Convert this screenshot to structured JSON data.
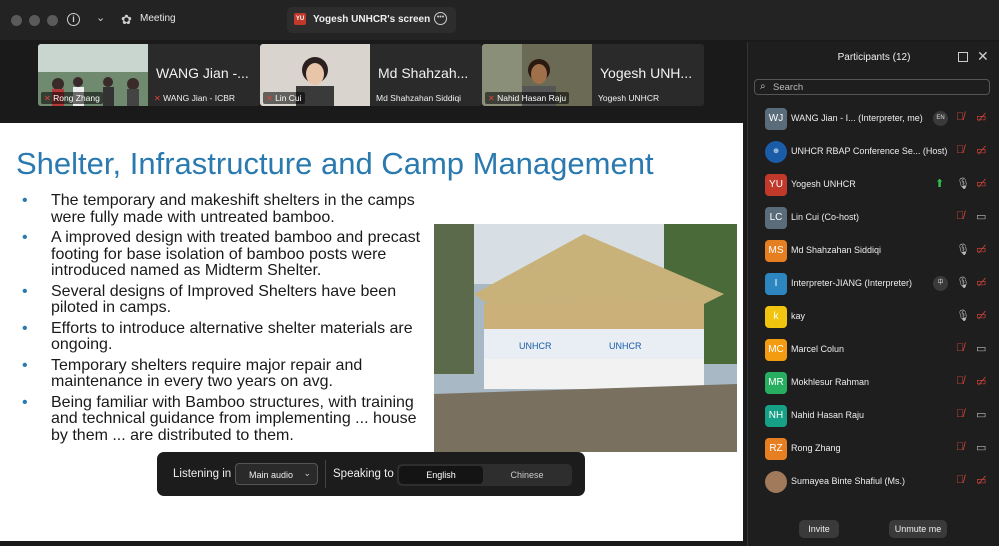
{
  "titlebar": {
    "meeting_label": "Meeting",
    "share_badge": "YU",
    "share_label": "Yogesh UNHCR's screen"
  },
  "strip": {
    "tiles": [
      {
        "thumb_label": "Rong Zhang",
        "big_name": "WANG Jian -...",
        "small_name": "WANG Jian - ICBR"
      },
      {
        "thumb_label": "Lin Cui",
        "big_name": "Md Shahzah...",
        "small_name": "Md Shahzahan Siddiqi"
      },
      {
        "thumb_label": "Nahid Hasan Raju",
        "big_name": "Yogesh UNH...",
        "small_name": "Yogesh UNHCR"
      }
    ]
  },
  "slide": {
    "title": "Shelter, Infrastructure and Camp Management",
    "bullets": [
      "The temporary and makeshift shelters in the camps were fully made with untreated bamboo.",
      "A improved design with treated bamboo and precast footing for base isolation of bamboo posts were introduced named as Midterm Shelter.",
      "Several designs of Improved Shelters have been piloted in camps.",
      "Efforts to introduce alternative shelter materials are ongoing.",
      "Temporary shelters require major repair and maintenance in every two years on avg.",
      "Being familiar with Bamboo structures, with training and technical guidance from implementing ... house by them ... are distributed to them."
    ],
    "photo_label": "UNHCR"
  },
  "interpretation": {
    "listening_label": "Listening in",
    "audio_value": "Main audio",
    "speaking_label": "Speaking to",
    "lang_active": "English",
    "lang_inactive": "Chinese"
  },
  "panel": {
    "title": "Participants (12)",
    "search_placeholder": "Search",
    "invite_label": "Invite",
    "unmute_label": "Unmute me",
    "participants": [
      {
        "initials": "WJ",
        "name": "WANG Jian - I...  (Interpreter, me)",
        "color": "#5a6b7a",
        "chip": "EN"
      },
      {
        "initials": "",
        "name": "UNHCR RBAP Conference Se... (Host)",
        "color": "#1a5ca8"
      },
      {
        "initials": "YU",
        "name": "Yogesh UNHCR",
        "color": "#c0392b"
      },
      {
        "initials": "LC",
        "name": "Lin Cui (Co-host)",
        "color": "#5a6b7a"
      },
      {
        "initials": "MS",
        "name": "Md Shahzahan Siddiqi",
        "color": "#e67e22"
      },
      {
        "initials": "I",
        "name": "Interpreter-JIANG (Interpreter)",
        "color": "#2e86c1",
        "chip": "中"
      },
      {
        "initials": "k",
        "name": "kay",
        "color": "#f1c40f"
      },
      {
        "initials": "MC",
        "name": "Marcel Colun",
        "color": "#f39c12"
      },
      {
        "initials": "MR",
        "name": "Mokhlesur Rahman",
        "color": "#27ae60"
      },
      {
        "initials": "NH",
        "name": "Nahid Hasan Raju",
        "color": "#16a085"
      },
      {
        "initials": "RZ",
        "name": "Rong Zhang",
        "color": "#e67e22"
      },
      {
        "initials": "",
        "name": "Sumayea Binte Shafiul (Ms.)",
        "color": "#a07a5a"
      }
    ]
  }
}
